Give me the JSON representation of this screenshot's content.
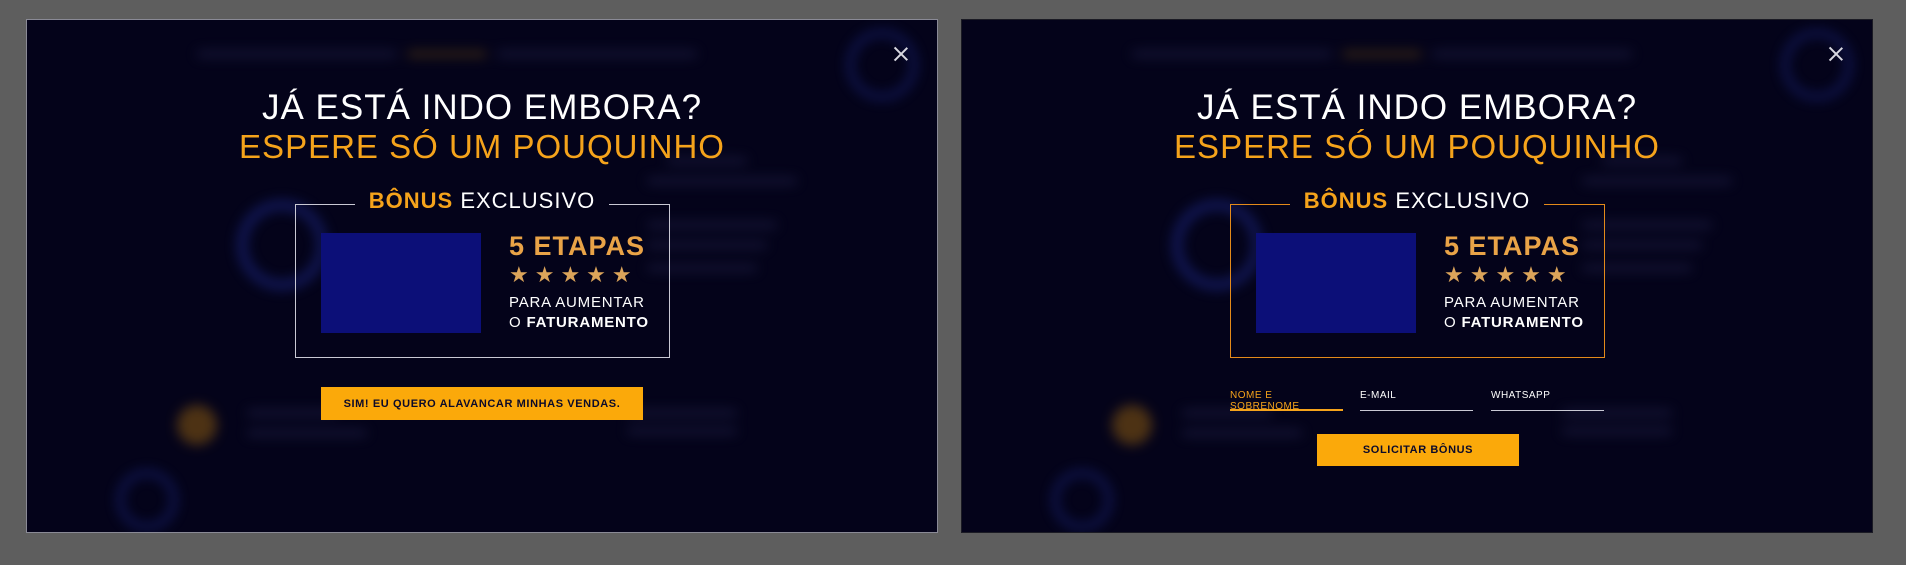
{
  "panels": [
    {
      "headline": "JÁ ESTÁ INDO EMBORA?",
      "subline": "ESPERE SÓ UM POUQUINHO",
      "bonus_strong": "BÔNUS",
      "bonus_rest": " EXCLUSIVO",
      "etapas": "5 ETAPAS",
      "stars": "★★★★★",
      "para_line1": "PARA AUMENTAR",
      "para_line2_prefix": "O ",
      "para_line2_bold": "FATURAMENTO",
      "cta_label": "SIM! EU QUERO ALAVANCAR MINHAS VENDAS."
    },
    {
      "headline": "JÁ ESTÁ INDO EMBORA?",
      "subline": "ESPERE SÓ UM POUQUINHO",
      "bonus_strong": "BÔNUS",
      "bonus_rest": " EXCLUSIVO",
      "etapas": "5 ETAPAS",
      "stars": "★★★★★",
      "para_line1": "PARA AUMENTAR",
      "para_line2_prefix": "O ",
      "para_line2_bold": "FATURAMENTO",
      "form": {
        "name_placeholder": "NOME E SOBRENOME",
        "email_placeholder": "E-MAIL",
        "whatsapp_placeholder": "WHATSAPP"
      },
      "submit_label": "SOLICITAR BÔNUS"
    }
  ],
  "colors": {
    "accent": "#f5a31b",
    "button": "#fba90a",
    "panel_bg": "#04031a",
    "product_placeholder": "#0c0f78"
  }
}
